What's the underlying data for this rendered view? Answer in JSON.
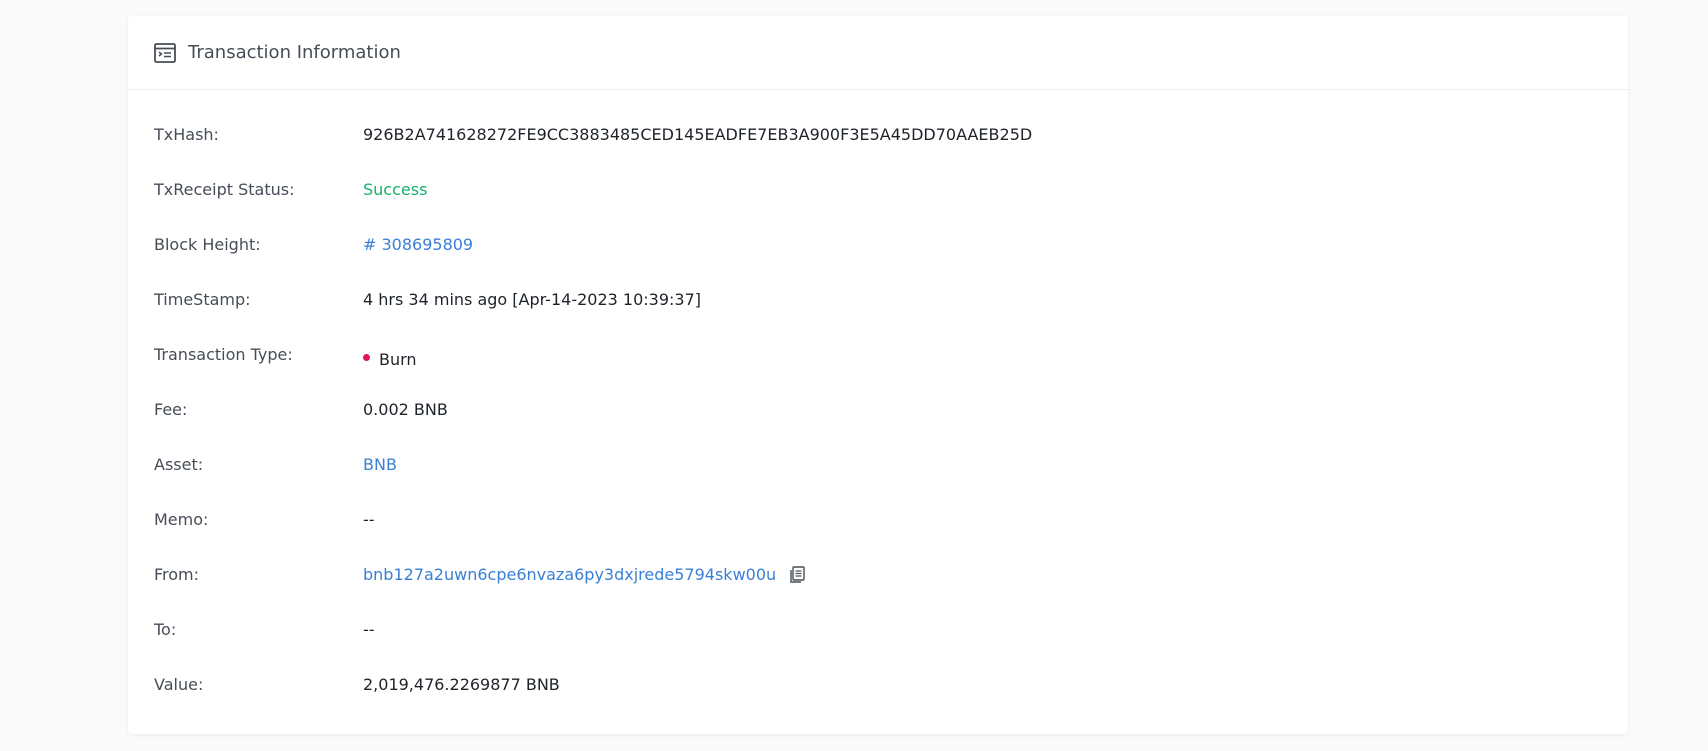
{
  "card": {
    "title": "Transaction Information",
    "title_icon": "transaction-doc-icon"
  },
  "rows": {
    "txhash": {
      "label": "TxHash:",
      "value": "926B2A741628272FE9CC3883485CED145EADFE7EB3A900F3E5A45DD70AAEB25D"
    },
    "status": {
      "label": "TxReceipt Status:",
      "value": "Success"
    },
    "block_height": {
      "label": "Block Height:",
      "value": "# 308695809"
    },
    "timestamp": {
      "label": "TimeStamp:",
      "value": "4 hrs 34 mins ago [Apr-14-2023 10:39:37]"
    },
    "tx_type": {
      "label": "Transaction Type:",
      "value": "Burn"
    },
    "fee": {
      "label": "Fee:",
      "value": "0.002 BNB"
    },
    "asset": {
      "label": "Asset:",
      "value": "BNB"
    },
    "memo": {
      "label": "Memo:",
      "value": "--"
    },
    "from": {
      "label": "From:",
      "value": "bnb127a2uwn6cpe6nvaza6py3dxjrede5794skw00u",
      "copy_icon": "copy-icon"
    },
    "to": {
      "label": "To:",
      "value": "--"
    },
    "value": {
      "label": "Value:",
      "value": "2,019,476.2269877 BNB"
    }
  },
  "colors": {
    "success": "#16b16b",
    "link": "#3a7fd6",
    "burn_dot": "#e0135e",
    "label": "#474d57",
    "text": "#1e2329"
  }
}
